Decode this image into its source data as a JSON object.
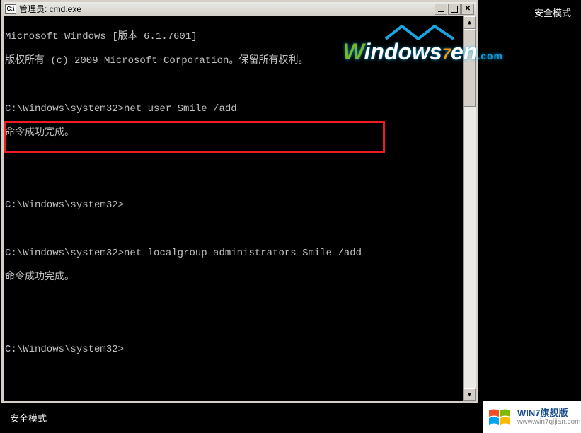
{
  "safe_mode_label": "安全模式",
  "safe_mode_bottom": "安全模式",
  "window": {
    "title": "管理员: cmd.exe",
    "icon_text": "C:\\"
  },
  "terminal": {
    "line1": "Microsoft Windows [版本 6.1.7601]",
    "line2": "版权所有 (c) 2009 Microsoft Corporation。保留所有权利。",
    "blank": "",
    "prompt1_path": "C:\\Windows\\system32>",
    "cmd1": "net user Smile /add",
    "result1": "命令成功完成。",
    "prompt2_path": "C:\\Windows\\system32>",
    "prompt3_path": "C:\\Windows\\system32>",
    "cmd2": "net localgroup administrators Smile /add",
    "result2": "命令成功完成。",
    "prompt4_path": "C:\\Windows\\system32>"
  },
  "watermark": {
    "w": "W",
    "text1": "indows",
    "seven": "7",
    "en": "en",
    "com": ".com"
  },
  "footer": {
    "title": "WIN7旗舰版",
    "url": "www.win7qijian.com"
  }
}
